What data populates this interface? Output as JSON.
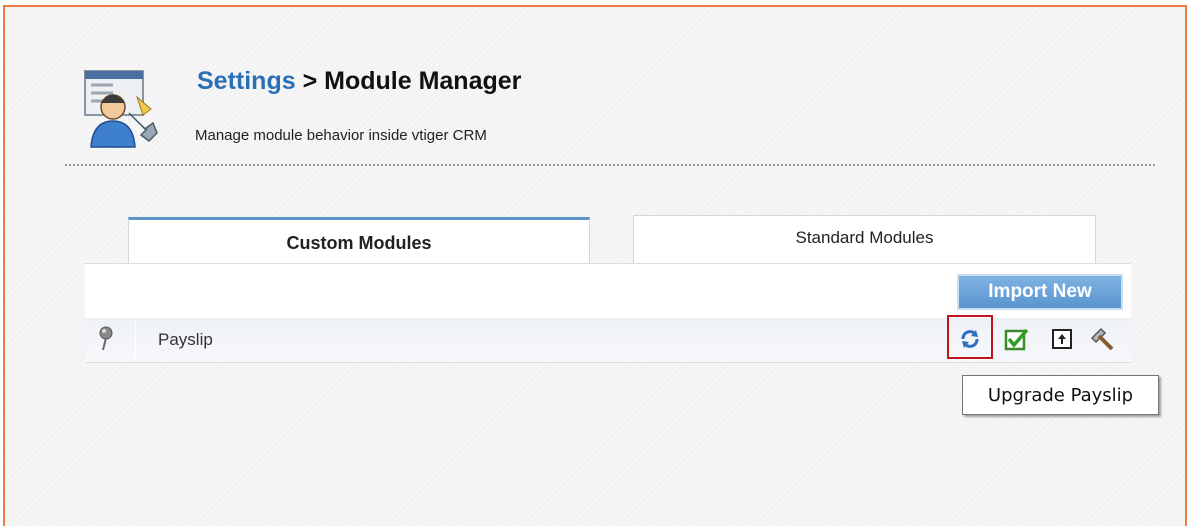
{
  "header": {
    "breadcrumb_link": "Settings",
    "breadcrumb_separator": ">",
    "title": "Module Manager",
    "subtitle": "Manage module behavior inside vtiger CRM",
    "icon": "settings-person-wrench-icon"
  },
  "tabs": [
    {
      "label": "Custom Modules",
      "active": true
    },
    {
      "label": "Standard Modules",
      "active": false
    }
  ],
  "toolbar": {
    "import_label": "Import New"
  },
  "modules": [
    {
      "name": "Payslip",
      "icon": "pin-icon",
      "actions": [
        "upgrade-icon",
        "enable-checkmark-icon",
        "export-arrow-icon",
        "settings-hammer-icon"
      ]
    }
  ],
  "tooltip": {
    "text": "Upgrade Payslip"
  },
  "colors": {
    "frame_border": "#ee7b45",
    "link_blue": "#2b6fb4",
    "tab_active_top": "#5b94c6",
    "import_button": "#6aa3da",
    "highlight_box": "#c0151c"
  }
}
